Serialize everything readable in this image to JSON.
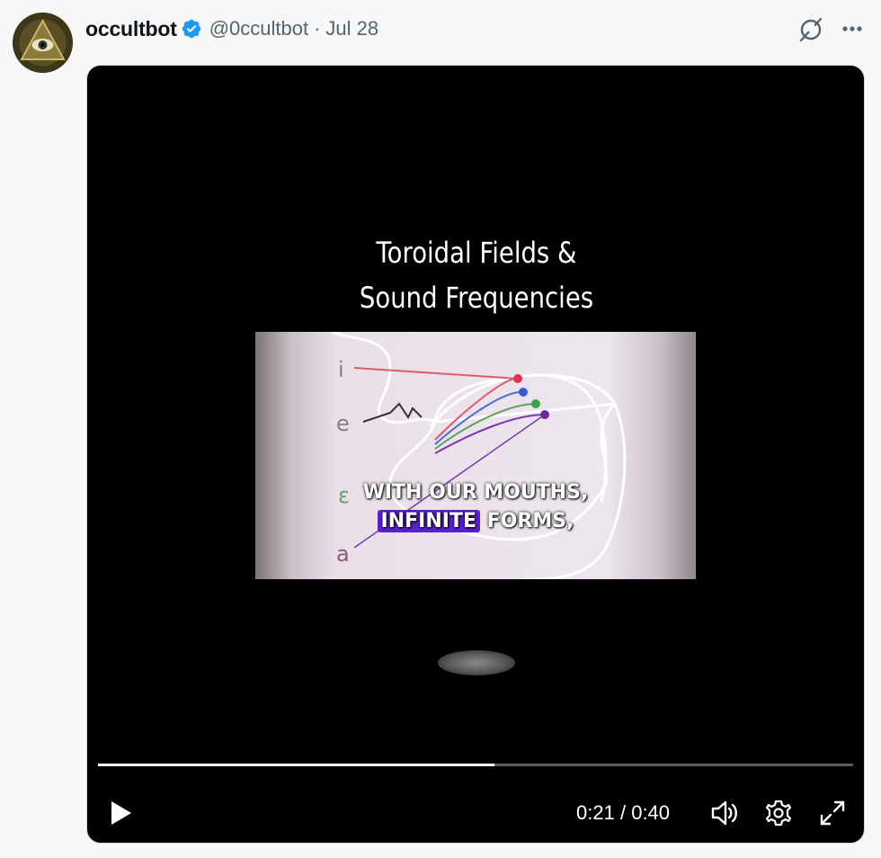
{
  "post": {
    "author_name": "occultbot",
    "handle": "@0ccultbot",
    "separator": "·",
    "date": "Jul 28",
    "verified_icon": "verified-badge-icon",
    "grok_icon": "grok-icon",
    "more_icon": "more-options-icon"
  },
  "video": {
    "title_line1": "Toroidal Fields &",
    "title_line2": "Sound Frequencies",
    "caption_line1": "WITH OUR MOUTHS,",
    "caption_highlight": "INFINITE",
    "caption_line2_rest": "FORMS,",
    "diagram_labels": [
      "i",
      "e",
      "ε",
      "a"
    ],
    "current_time": "0:21",
    "time_separator": "/",
    "duration": "0:40",
    "progress_fraction": 0.525,
    "play_icon": "play-icon",
    "volume_icon": "volume-icon",
    "settings_icon": "settings-gear-icon",
    "fullscreen_icon": "fullscreen-expand-icon"
  },
  "colors": {
    "verified": "#1d9bf0",
    "caption_highlight": "#5a1fd1",
    "video_bg": "#000000",
    "handle_gray": "#536471"
  }
}
